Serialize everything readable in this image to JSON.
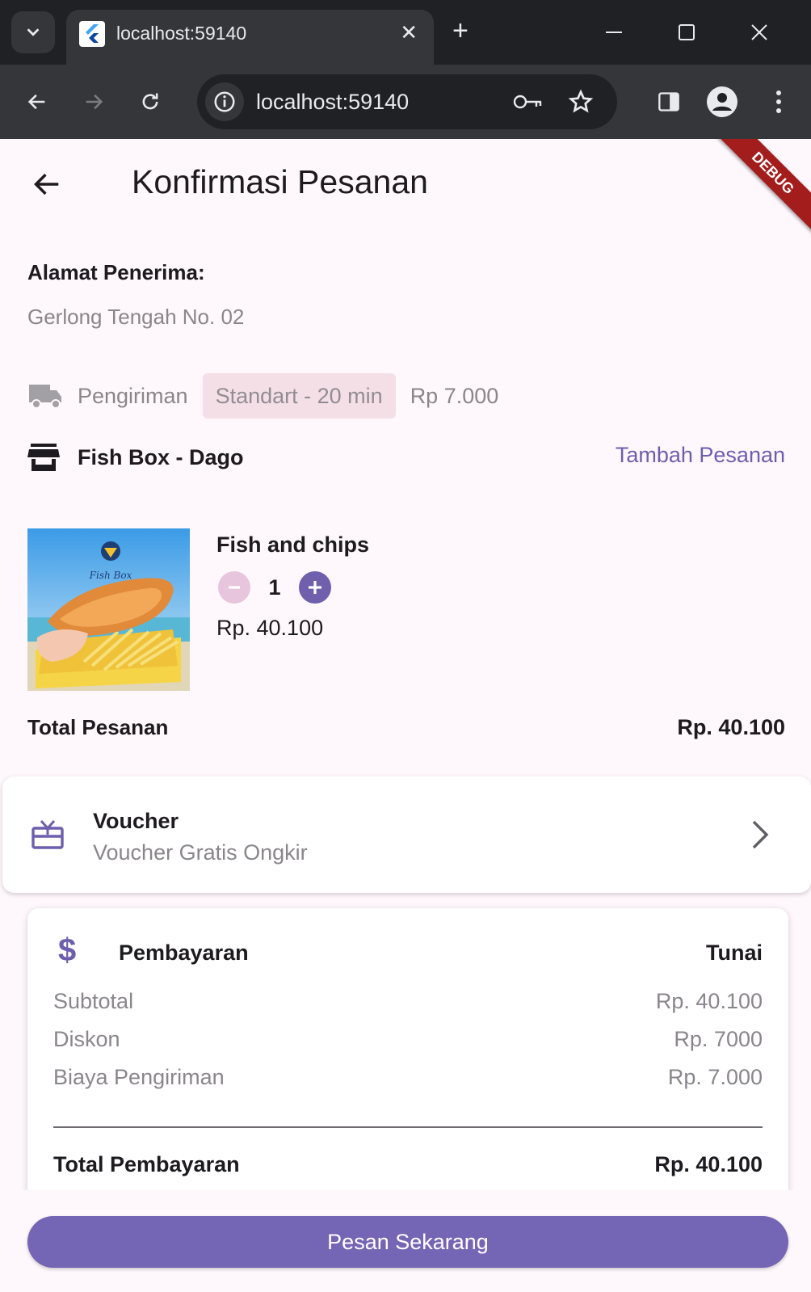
{
  "browser": {
    "tab_title": "localhost:59140",
    "url": "localhost:59140"
  },
  "appbar": {
    "title": "Konfirmasi Pesanan",
    "debug_label": "DEBUG"
  },
  "address": {
    "label": "Alamat Penerima:",
    "value": "Gerlong Tengah No. 02"
  },
  "shipping": {
    "label": "Pengiriman",
    "option": "Standart - 20 min",
    "price": "Rp 7.000"
  },
  "store": {
    "name": "Fish Box - Dago",
    "add_label": "Tambah Pesanan"
  },
  "item": {
    "name": "Fish and chips",
    "quantity": "1",
    "price": "Rp. 40.100",
    "image_brand": "Fish Box"
  },
  "order_total": {
    "label": "Total Pesanan",
    "value": "Rp. 40.100"
  },
  "voucher": {
    "title": "Voucher",
    "subtitle": "Voucher Gratis Ongkir"
  },
  "payment": {
    "title": "Pembayaran",
    "method": "Tunai",
    "rows": [
      {
        "label": "Subtotal",
        "value": "Rp. 40.100"
      },
      {
        "label": "Diskon",
        "value": "Rp. 7000"
      },
      {
        "label": "Biaya Pengiriman",
        "value": "Rp. 7.000"
      }
    ],
    "total_label": "Total Pembayaran",
    "total_value": "Rp. 40.100"
  },
  "cta": {
    "label": "Pesan Sekarang"
  },
  "colors": {
    "accent": "#6d5fae",
    "button": "#7565b5",
    "background": "#fef7fb",
    "chip": "#f4dfe6"
  }
}
